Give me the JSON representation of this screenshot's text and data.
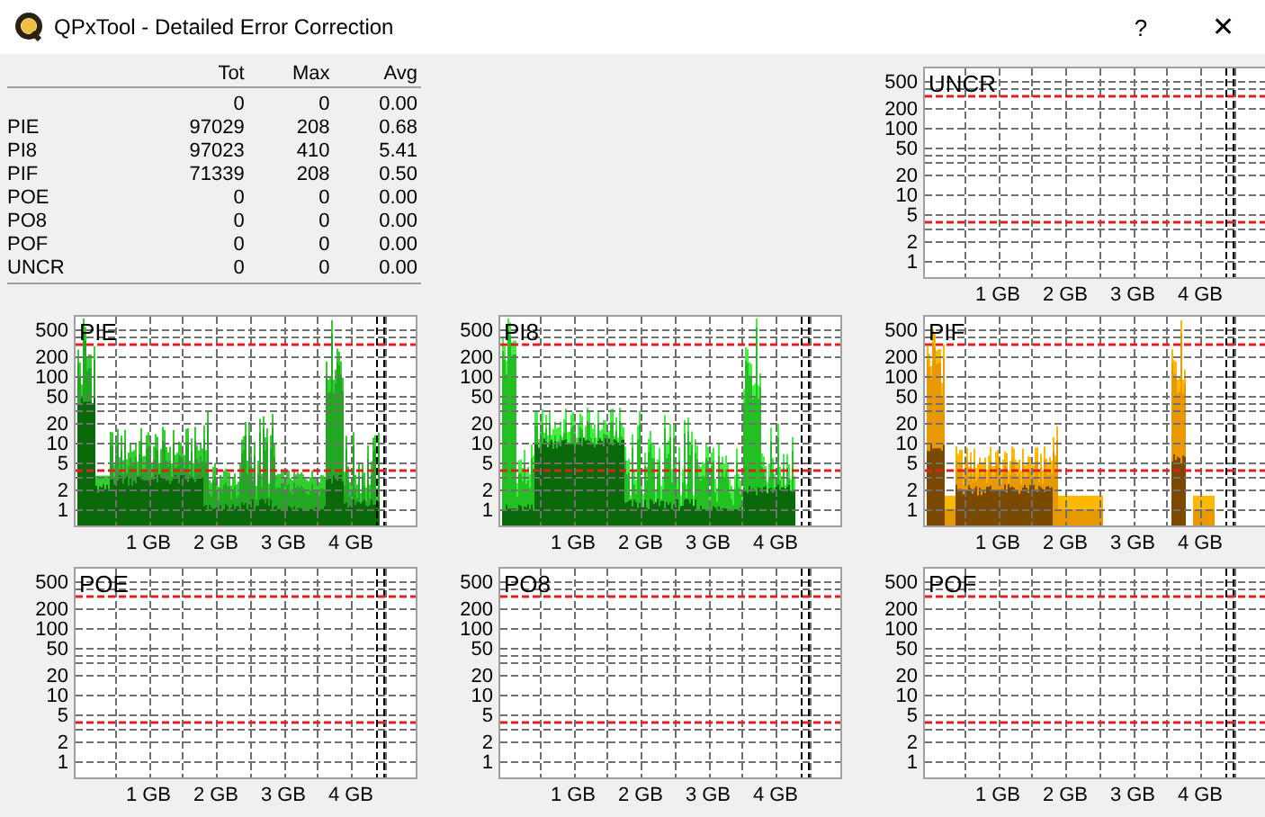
{
  "window": {
    "title": "QPxTool - Detailed Error Correction",
    "help_button": "?",
    "close_button": "✕"
  },
  "table": {
    "columns": [
      "",
      "Tot",
      "Max",
      "Avg"
    ],
    "rows": [
      [
        "",
        "0",
        "0",
        "0.00"
      ],
      [
        "PIE",
        "97029",
        "208",
        "0.68"
      ],
      [
        "PI8",
        "97023",
        "410",
        "5.41"
      ],
      [
        "PIF",
        "71339",
        "208",
        "0.50"
      ],
      [
        "POE",
        "0",
        "0",
        "0.00"
      ],
      [
        "PO8",
        "0",
        "0",
        "0.00"
      ],
      [
        "POF",
        "0",
        "0",
        "0.00"
      ],
      [
        "UNCR",
        "0",
        "0",
        "0.00"
      ]
    ]
  },
  "charts": [
    {
      "title": "UNCR",
      "kind": "empty",
      "yticks": [
        "500",
        "200",
        "100",
        "50",
        "20",
        "10",
        "5",
        "2",
        "1"
      ],
      "xticks": [
        "1 GB",
        "2 GB",
        "3 GB",
        "4 GB"
      ]
    },
    {
      "title": "PIE",
      "kind": "pie",
      "yticks": [
        "500",
        "200",
        "100",
        "50",
        "20",
        "10",
        "5",
        "2",
        "1"
      ],
      "xticks": [
        "1 GB",
        "2 GB",
        "3 GB",
        "4 GB"
      ]
    },
    {
      "title": "PI8",
      "kind": "pi8",
      "yticks": [
        "500",
        "200",
        "100",
        "50",
        "20",
        "10",
        "5",
        "2",
        "1"
      ],
      "xticks": [
        "1 GB",
        "2 GB",
        "3 GB",
        "4 GB"
      ]
    },
    {
      "title": "PIF",
      "kind": "pif",
      "yticks": [
        "500",
        "200",
        "100",
        "50",
        "20",
        "10",
        "5",
        "2",
        "1"
      ],
      "xticks": [
        "1 GB",
        "2 GB",
        "3 GB",
        "4 GB"
      ]
    },
    {
      "title": "POE",
      "kind": "empty",
      "yticks": [
        "500",
        "200",
        "100",
        "50",
        "20",
        "10",
        "5",
        "2",
        "1"
      ],
      "xticks": [
        "1 GB",
        "2 GB",
        "3 GB",
        "4 GB"
      ]
    },
    {
      "title": "PO8",
      "kind": "empty",
      "yticks": [
        "500",
        "200",
        "100",
        "50",
        "20",
        "10",
        "5",
        "2",
        "1"
      ],
      "xticks": [
        "1 GB",
        "2 GB",
        "3 GB",
        "4 GB"
      ]
    },
    {
      "title": "POF",
      "kind": "empty",
      "yticks": [
        "500",
        "200",
        "100",
        "50",
        "20",
        "10",
        "5",
        "2",
        "1"
      ],
      "xticks": [
        "1 GB",
        "2 GB",
        "3 GB",
        "4 GB"
      ]
    }
  ]
}
